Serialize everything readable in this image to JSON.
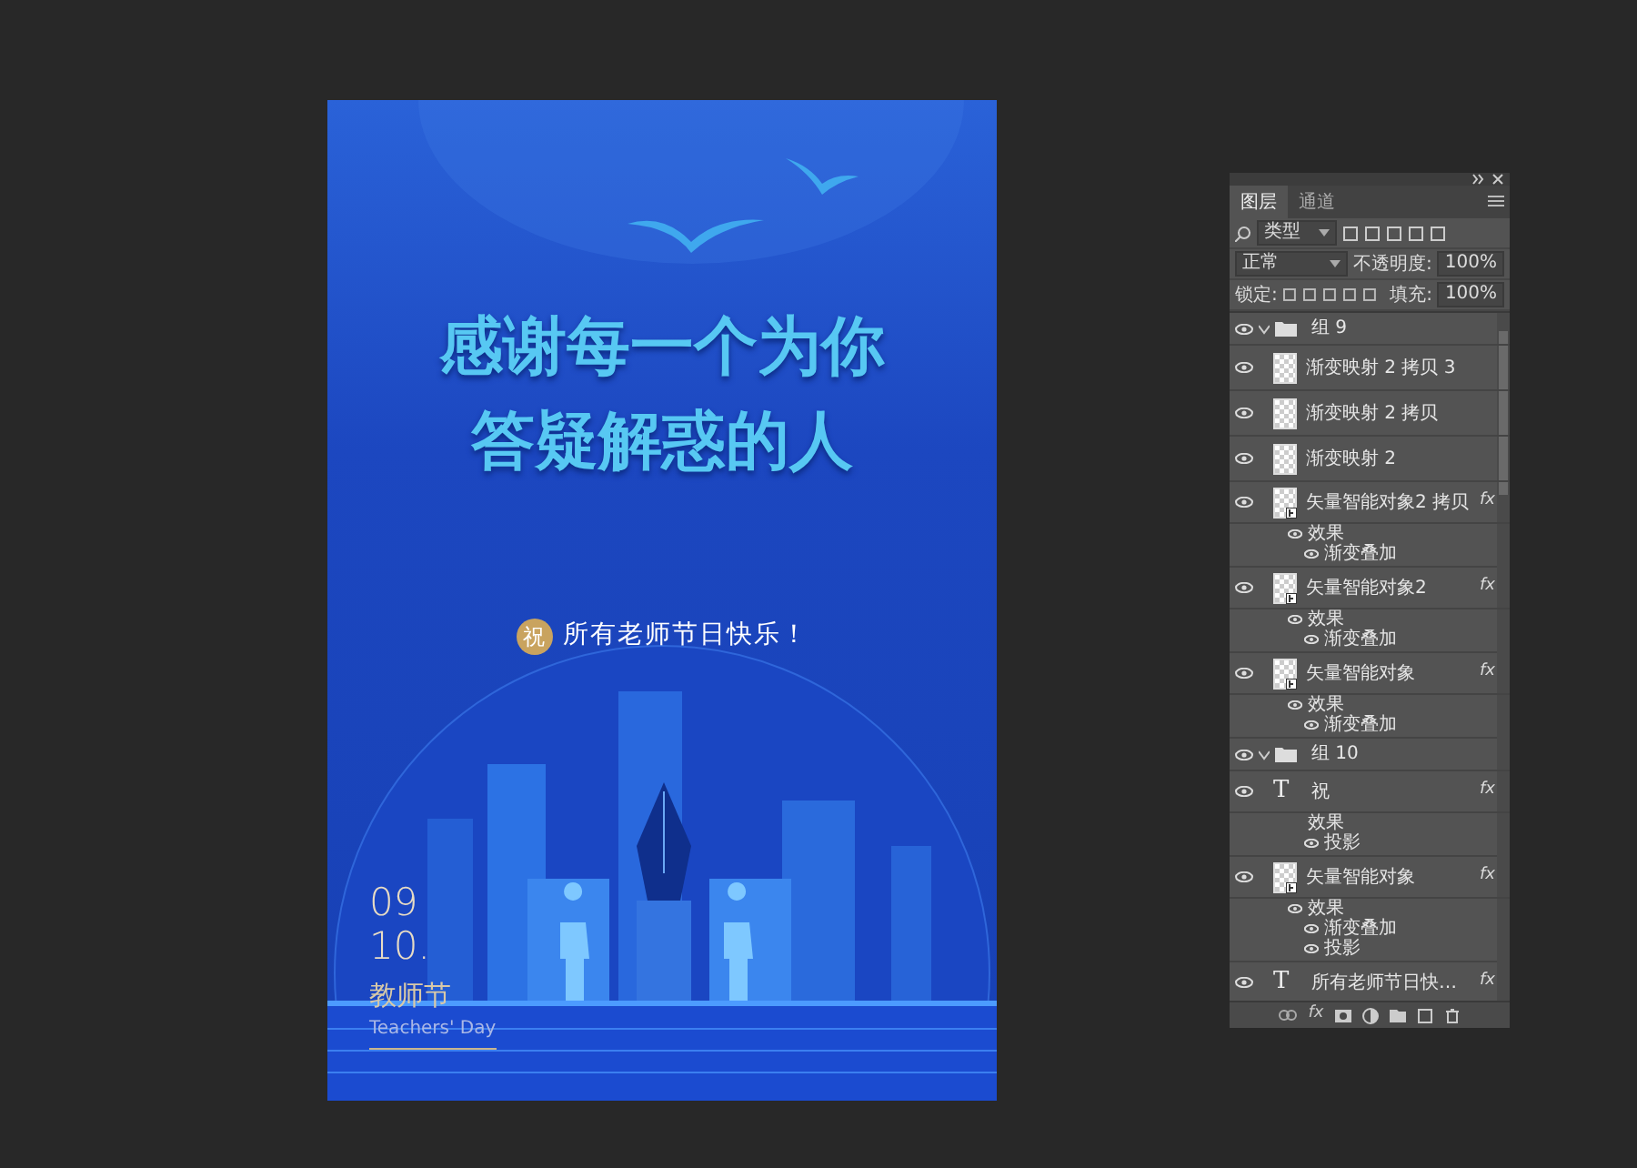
{
  "poster": {
    "headline": [
      "感谢每一个为你",
      "答疑解惑的人"
    ],
    "greeting_seal": "祝",
    "greeting": "所有老师节日快乐！",
    "date_month": "09",
    "date_day": "10.",
    "holiday": "教师节",
    "holiday_en": "Teachers' Day"
  },
  "layers_panel": {
    "tabs": [
      {
        "label": "图层",
        "selected": true
      },
      {
        "label": "通道",
        "selected": false
      }
    ],
    "filter": "类型",
    "blend_mode": "正常",
    "opacity_label": "不透明度:",
    "opacity": "100%",
    "lock_label": "锁定:",
    "fill_label": "填充:",
    "fill": "100%",
    "layers": [
      {
        "kind": "group",
        "name": "组 9",
        "visible": true,
        "expanded": true,
        "children": [
          {
            "kind": "raster",
            "name": "渐变映射 2 拷贝 3",
            "visible": true
          },
          {
            "kind": "raster",
            "name": "渐变映射 2 拷贝",
            "visible": true
          },
          {
            "kind": "raster",
            "name": "渐变映射 2",
            "visible": true
          },
          {
            "kind": "smart",
            "name": "矢量智能对象2 拷贝",
            "visible": true,
            "fx": "fx",
            "effects": {
              "label": "效果",
              "visible": true,
              "items": [
                {
                  "name": "渐变叠加",
                  "visible": true
                }
              ]
            }
          },
          {
            "kind": "smart",
            "name": "矢量智能对象2",
            "visible": true,
            "fx": "fx",
            "effects": {
              "label": "效果",
              "visible": true,
              "items": [
                {
                  "name": "渐变叠加",
                  "visible": true
                }
              ]
            }
          },
          {
            "kind": "smart",
            "name": "矢量智能对象",
            "visible": true,
            "fx": "fx",
            "effects": {
              "label": "效果",
              "visible": true,
              "items": [
                {
                  "name": "渐变叠加",
                  "visible": true
                }
              ]
            }
          }
        ]
      },
      {
        "kind": "group",
        "name": "组 10",
        "visible": true,
        "expanded": true,
        "children": [
          {
            "kind": "text",
            "glyph": "T",
            "name": "祝",
            "visible": true,
            "fx": "fx",
            "effects": {
              "label": "效果",
              "visible": false,
              "items": [
                {
                  "name": "投影",
                  "visible": true
                }
              ]
            }
          },
          {
            "kind": "smart",
            "name": "矢量智能对象",
            "visible": true,
            "fx": "fx",
            "effects": {
              "label": "效果",
              "visible": true,
              "items": [
                {
                  "name": "渐变叠加",
                  "visible": true
                },
                {
                  "name": "投影",
                  "visible": true
                }
              ]
            }
          },
          {
            "kind": "text",
            "glyph": "T",
            "name": "所有老师节日快…",
            "visible": true,
            "fx": "fx"
          }
        ]
      }
    ],
    "toolbar_fx": "fx"
  }
}
